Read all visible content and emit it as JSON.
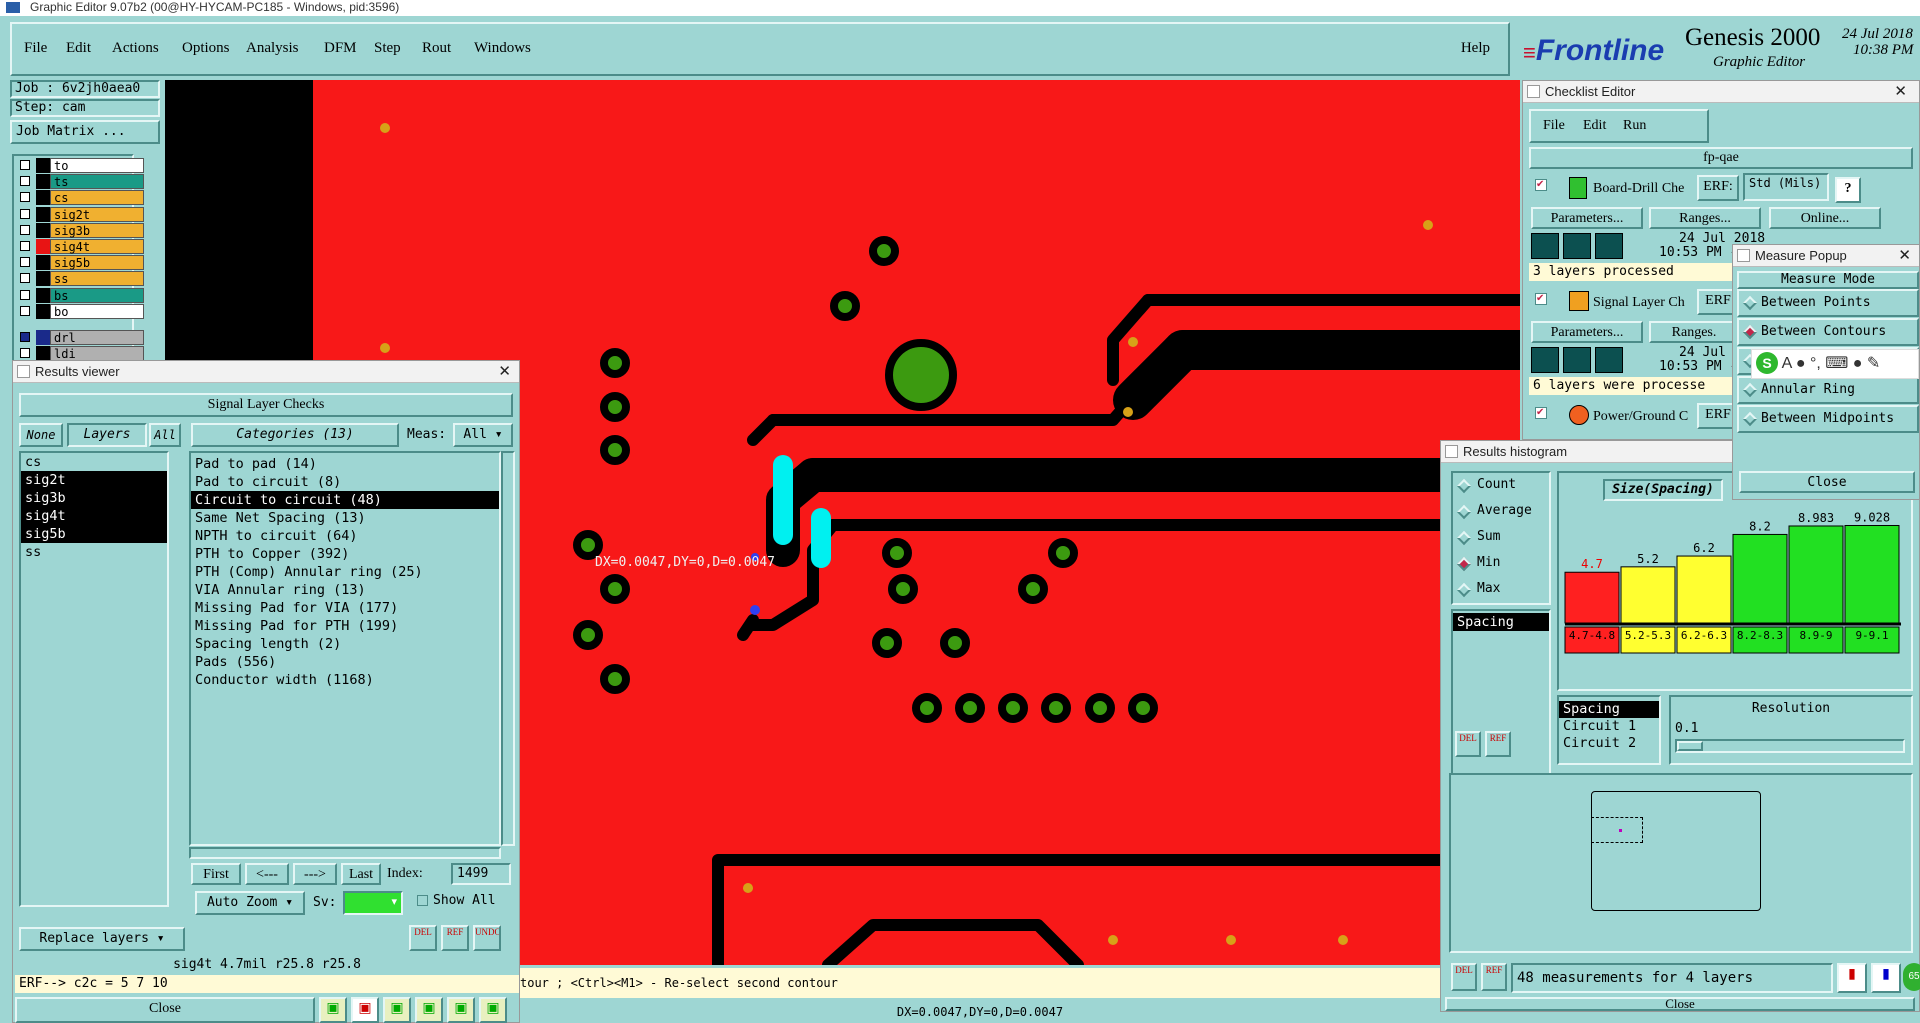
{
  "app_title": "Graphic Editor 9.07b2 (00@HY-HYCAM-PC185 - Windows, pid:3596)",
  "menu": [
    "File",
    "Edit",
    "Actions",
    "Options",
    "Analysis",
    "DFM",
    "Step",
    "Rout",
    "Windows"
  ],
  "help_label": "Help",
  "brand": {
    "logo": "Frontline",
    "product": "Genesis 2000",
    "subtitle": "Graphic Editor",
    "date": "24 Jul 2018",
    "time": "10:38 PM"
  },
  "job": {
    "job": "Job : 6v2jh0aea0",
    "step": "Step: cam",
    "matrix": "Job Matrix ..."
  },
  "layers": [
    {
      "name": "to",
      "color": "#ffffff",
      "swatch": "#000000",
      "sel": false
    },
    {
      "name": "ts",
      "color": "#1a9a86",
      "swatch": "#000000",
      "sel": false
    },
    {
      "name": "cs",
      "color": "#f0b030",
      "swatch": "#000000",
      "sel": false
    },
    {
      "name": "sig2t",
      "color": "#f0b030",
      "swatch": "#000000",
      "sel": false
    },
    {
      "name": "sig3b",
      "color": "#f0b030",
      "swatch": "#000000",
      "sel": false
    },
    {
      "name": "sig4t",
      "color": "#f0b030",
      "swatch": "#e81414",
      "sel": false
    },
    {
      "name": "sig5b",
      "color": "#f0b030",
      "swatch": "#000000",
      "sel": false
    },
    {
      "name": "ss",
      "color": "#f0b030",
      "swatch": "#000000",
      "sel": false
    },
    {
      "name": "bs",
      "color": "#1a9a86",
      "swatch": "#000000",
      "sel": false
    },
    {
      "name": "bo",
      "color": "#ffffff",
      "swatch": "#000000",
      "sel": false
    },
    {
      "name": "drl",
      "color": "#b0b0b0",
      "swatch": "#1a2a8a",
      "sel": true
    },
    {
      "name": "ldi",
      "color": "#b0b0b0",
      "swatch": "#000000",
      "sel": false
    }
  ],
  "results_viewer": {
    "title": "Results viewer",
    "header": "Signal Layer Checks",
    "none": "None",
    "layers_tab": "Layers",
    "all": "All",
    "categories_tab": "Categories (13)",
    "meas_label": "Meas:",
    "meas_value": "All",
    "layer_list": [
      {
        "t": "cs",
        "sel": false
      },
      {
        "t": "sig2t",
        "sel": true
      },
      {
        "t": "sig3b",
        "sel": true
      },
      {
        "t": "sig4t",
        "sel": true
      },
      {
        "t": "sig5b",
        "sel": true
      },
      {
        "t": "ss",
        "sel": false
      }
    ],
    "category_list": [
      {
        "t": "Pad to pad (14)",
        "sel": false
      },
      {
        "t": "Pad to circuit (8)",
        "sel": false
      },
      {
        "t": "Circuit to circuit (48)",
        "sel": true
      },
      {
        "t": "Same Net Spacing (13)",
        "sel": false
      },
      {
        "t": "NPTH to circuit (64)",
        "sel": false
      },
      {
        "t": "PTH to Copper (392)",
        "sel": false
      },
      {
        "t": "PTH (Comp) Annular ring (25)",
        "sel": false
      },
      {
        "t": "VIA Annular ring (13)",
        "sel": false
      },
      {
        "t": "Missing Pad for VIA (177)",
        "sel": false
      },
      {
        "t": "Missing Pad for PTH (199)",
        "sel": false
      },
      {
        "t": "Spacing length (2)",
        "sel": false
      },
      {
        "t": "Pads (556)",
        "sel": false
      },
      {
        "t": "Conductor width (1168)",
        "sel": false
      }
    ],
    "first": "First",
    "prev": "<---",
    "next": "--->",
    "last": "Last",
    "index_label": "Index:",
    "index_value": "1499",
    "autozoom": "Auto Zoom",
    "sv": "Sv:",
    "show_all": "Show All",
    "replace_layers": "Replace layers",
    "status": "sig4t 4.7mil  r25.8  r25.8",
    "erf": "ERF--> c2c = 5 7 10",
    "close": "Close"
  },
  "canvas": {
    "measure_text": "DX=0.0047,DY=0,D=0.0047",
    "status_msg": "tour ; <Ctrl><M1> - Re-select second contour",
    "bottom_readout": "DX=0.0047,DY=0,D=0.0047"
  },
  "checklist": {
    "title": "Checklist Editor",
    "menu": [
      "File",
      "Edit",
      "Run"
    ],
    "name": "fp-qae",
    "items": [
      {
        "label": "Board-Drill Che",
        "erf": "ERF:",
        "erf_val": "Std (Mils)",
        "date": "24 Jul 2018",
        "time": "10:53 PM -",
        "status": "3 layers processed"
      },
      {
        "label": "Signal Layer Ch",
        "erf": "ERF",
        "erf_val": "",
        "date": "24 Jul",
        "time": "10:53 PM -",
        "status": "6 layers were processe"
      },
      {
        "label": "Power/Ground C",
        "erf": "ERF",
        "erf_val": "",
        "date": "",
        "time": "",
        "status": ""
      }
    ],
    "parameters": "Parameters...",
    "ranges": "Ranges...",
    "ranges2": "Ranges.",
    "online": "Online...",
    "help": "?"
  },
  "measure_popup": {
    "title": "Measure Popup",
    "header": "Measure Mode",
    "options": [
      {
        "t": "Between Points",
        "on": false
      },
      {
        "t": "Between Contours",
        "on": true
      },
      {
        "t": "",
        "on": false
      },
      {
        "t": "Annular Ring",
        "on": false
      },
      {
        "t": "Between Midpoints",
        "on": false
      }
    ],
    "close": "Close"
  },
  "histogram": {
    "title": "Results histogram",
    "modes": [
      {
        "t": "Count",
        "on": false
      },
      {
        "t": "Average",
        "on": false
      },
      {
        "t": "Sum",
        "on": false
      },
      {
        "t": "Min",
        "on": true
      },
      {
        "t": "Max",
        "on": false
      }
    ],
    "list_item": "Spacing",
    "chart_title": "Size(Spacing)",
    "resolution_label": "Resolution",
    "resolution_value": "0.1",
    "fields": [
      {
        "t": "Spacing",
        "sel": true
      },
      {
        "t": "Circuit 1",
        "sel": false
      },
      {
        "t": "Circuit 2",
        "sel": false
      }
    ],
    "footer": "48 measurements for 4 layers",
    "close": "Close",
    "badge": "65"
  },
  "chart_data": {
    "type": "bar",
    "title": "Size(Spacing)",
    "categories": [
      "4.7-4.8",
      "5.2-5.3",
      "6.2-6.3",
      "8.2-8.3",
      "8.9-9",
      "9-9.1"
    ],
    "values": [
      4.7,
      5.2,
      6.2,
      8.2,
      8.983,
      9.028
    ],
    "value_labels": [
      "4.7",
      "5.2",
      "6.2",
      "8.2",
      "8.983",
      "9.028"
    ],
    "colors": [
      "#ff2020",
      "#ffff30",
      "#ffff30",
      "#22e022",
      "#22e022",
      "#22e022"
    ],
    "ylim": [
      0,
      10
    ]
  }
}
